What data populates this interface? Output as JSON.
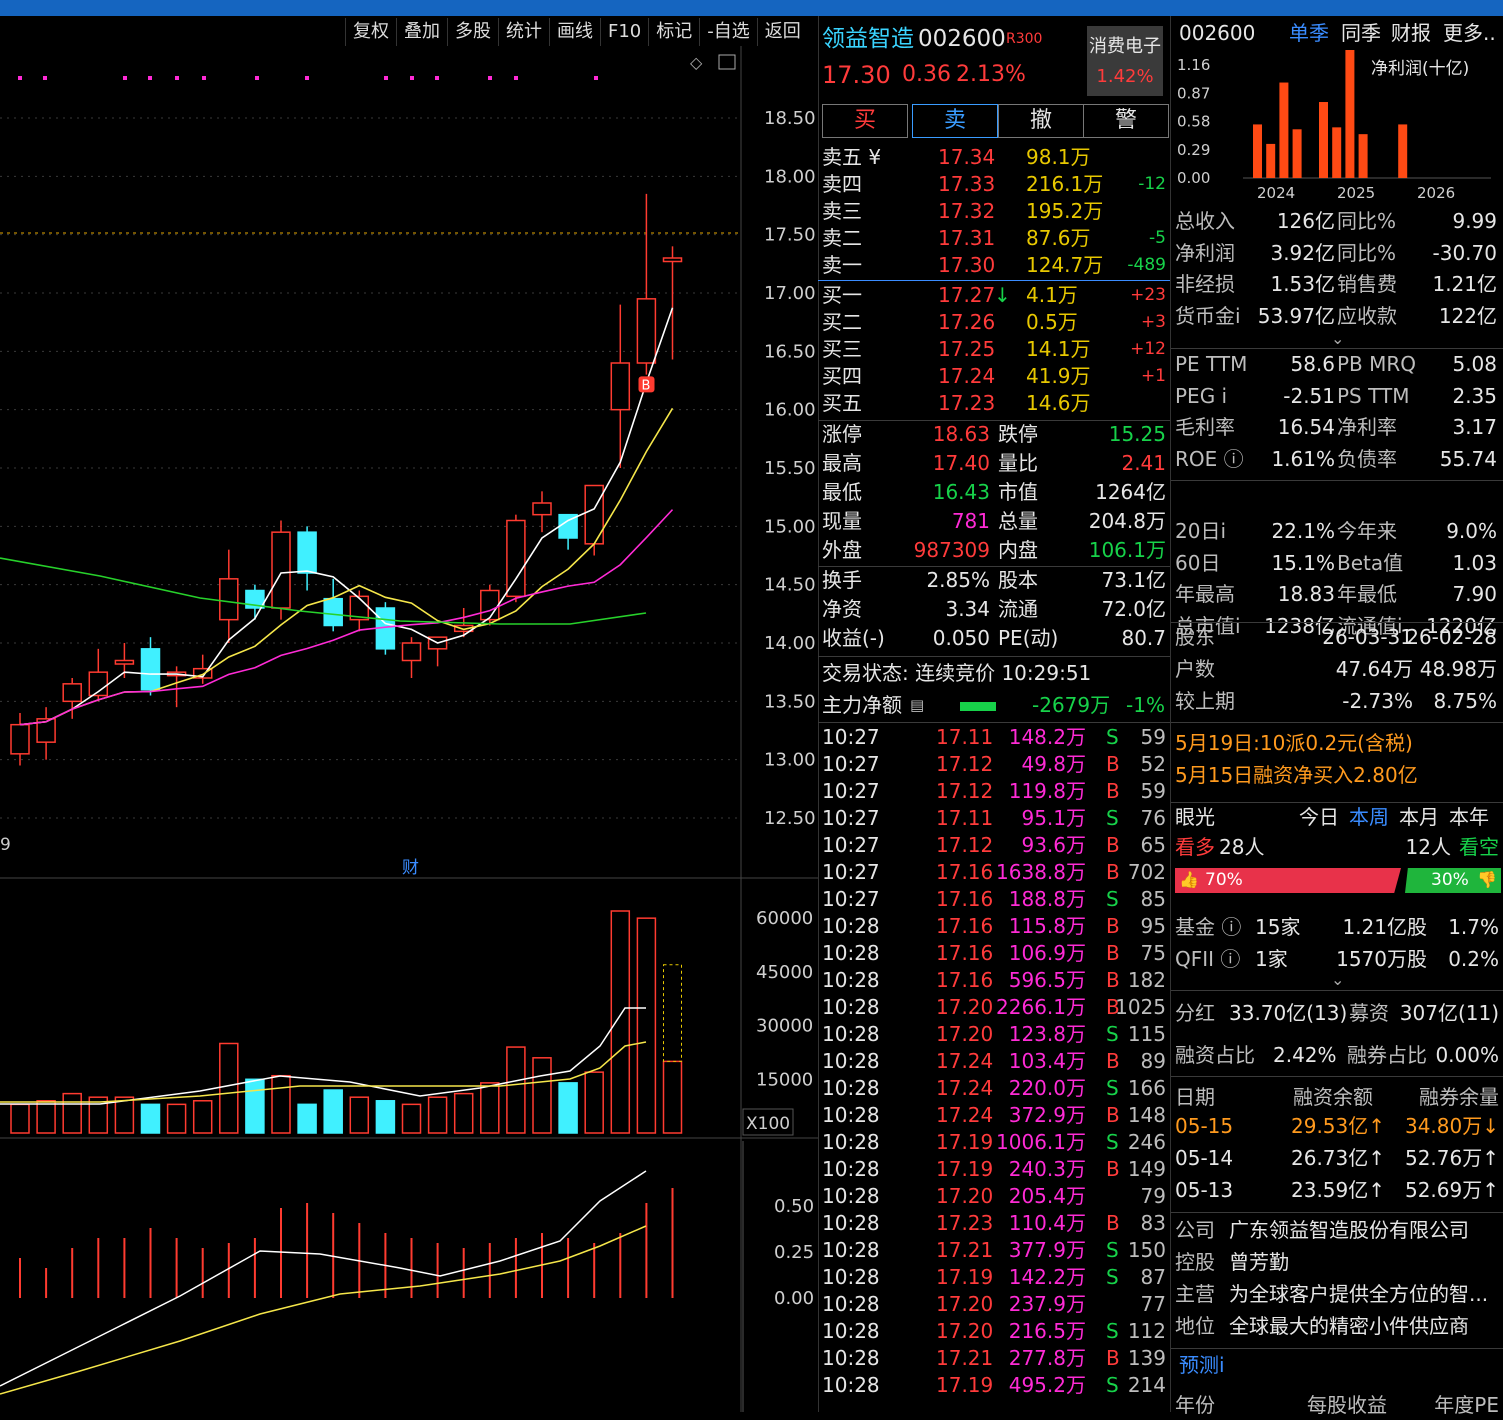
{
  "toolbar": [
    "复权",
    "叠加",
    "多股",
    "统计",
    "画线",
    "F10",
    "标记",
    "-自选",
    "返回"
  ],
  "chart": {
    "price_axis": [
      "18.50",
      "18.00",
      "17.50",
      "17.00",
      "16.50",
      "16.00",
      "15.50",
      "15.00",
      "14.50",
      "14.00",
      "13.50",
      "13.00",
      "12.50"
    ],
    "volume_axis": [
      "60000",
      "45000",
      "30000",
      "15000"
    ],
    "volume_unit": "X100",
    "macd_axis": [
      "0.50",
      "0.25",
      "0.00"
    ],
    "date_stub": "9",
    "fin_marker": "财",
    "buy_marker": "B",
    "colors": {
      "up": "#ff3b30",
      "down": "#40f0ff",
      "ma5": "#ffffff",
      "ma10": "#f5e64a",
      "ma20": "#ff2bd6",
      "ma60": "#27d12b"
    },
    "candles": [
      {
        "o": 13.05,
        "h": 13.4,
        "l": 12.95,
        "c": 13.3,
        "up": true
      },
      {
        "o": 13.15,
        "h": 13.45,
        "l": 13.0,
        "c": 13.35,
        "up": true
      },
      {
        "o": 13.5,
        "h": 13.7,
        "l": 13.35,
        "c": 13.65,
        "up": true
      },
      {
        "o": 13.55,
        "h": 13.95,
        "l": 13.5,
        "c": 13.75,
        "up": true
      },
      {
        "o": 13.82,
        "h": 14.0,
        "l": 13.7,
        "c": 13.85,
        "up": true
      },
      {
        "o": 13.95,
        "h": 14.05,
        "l": 13.55,
        "c": 13.6,
        "up": false
      },
      {
        "o": 13.72,
        "h": 13.8,
        "l": 13.45,
        "c": 13.75,
        "up": true
      },
      {
        "o": 13.7,
        "h": 13.9,
        "l": 13.65,
        "c": 13.78,
        "up": true
      },
      {
        "o": 14.2,
        "h": 14.8,
        "l": 14.0,
        "c": 14.55,
        "up": true
      },
      {
        "o": 14.45,
        "h": 14.5,
        "l": 14.2,
        "c": 14.3,
        "up": false
      },
      {
        "o": 14.3,
        "h": 15.05,
        "l": 14.2,
        "c": 14.95,
        "up": true
      },
      {
        "o": 14.95,
        "h": 15.0,
        "l": 14.45,
        "c": 14.6,
        "up": false
      },
      {
        "o": 14.38,
        "h": 14.55,
        "l": 14.1,
        "c": 14.15,
        "up": false
      },
      {
        "o": 14.2,
        "h": 14.45,
        "l": 14.1,
        "c": 14.4,
        "up": true
      },
      {
        "o": 14.3,
        "h": 14.35,
        "l": 13.9,
        "c": 13.95,
        "up": false
      },
      {
        "o": 13.85,
        "h": 14.05,
        "l": 13.7,
        "c": 14.0,
        "up": true
      },
      {
        "o": 13.95,
        "h": 14.05,
        "l": 13.8,
        "c": 14.05,
        "up": true
      },
      {
        "o": 14.1,
        "h": 14.3,
        "l": 14.05,
        "c": 14.15,
        "up": true
      },
      {
        "o": 14.2,
        "h": 14.5,
        "l": 14.15,
        "c": 14.45,
        "up": true
      },
      {
        "o": 14.4,
        "h": 15.1,
        "l": 14.35,
        "c": 15.05,
        "up": true
      },
      {
        "o": 15.1,
        "h": 15.3,
        "l": 14.95,
        "c": 15.2,
        "up": true
      },
      {
        "o": 15.1,
        "h": 15.1,
        "l": 14.8,
        "c": 14.9,
        "up": false
      },
      {
        "o": 14.85,
        "h": 15.35,
        "l": 14.75,
        "c": 15.35,
        "up": true
      },
      {
        "o": 16.0,
        "h": 16.9,
        "l": 15.5,
        "c": 16.4,
        "up": true
      },
      {
        "o": 16.4,
        "h": 17.85,
        "l": 16.3,
        "c": 16.95,
        "up": true
      },
      {
        "o": 17.3,
        "h": 17.4,
        "l": 16.43,
        "c": 17.27,
        "up": true
      }
    ],
    "volumes": [
      8000,
      9000,
      11000,
      10000,
      10000,
      8000,
      8000,
      9000,
      25000,
      15000,
      16000,
      8000,
      12000,
      10000,
      9000,
      8000,
      10000,
      11000,
      14000,
      24000,
      21000,
      14000,
      17000,
      62000,
      60000,
      20000
    ]
  },
  "quote": {
    "name": "领益智造",
    "code": "002600",
    "rank": "R300",
    "sector": "消费电子",
    "sector_pct": "1.42%",
    "price": "17.30",
    "change": "0.36",
    "pct": "2.13%",
    "buttons": [
      "买",
      "卖",
      "撤",
      "警"
    ],
    "sells": [
      {
        "label": "卖五 ¥",
        "price": "17.34",
        "vol": "98.1万",
        "diff": ""
      },
      {
        "label": "卖四",
        "price": "17.33",
        "vol": "216.1万",
        "diff": "-12"
      },
      {
        "label": "卖三",
        "price": "17.32",
        "vol": "195.2万",
        "diff": ""
      },
      {
        "label": "卖二",
        "price": "17.31",
        "vol": "87.6万",
        "diff": "-5"
      },
      {
        "label": "卖一",
        "price": "17.30",
        "vol": "124.7万",
        "diff": "-489"
      }
    ],
    "buys": [
      {
        "label": "买一",
        "price": "17.27",
        "vol": "4.1万",
        "diff": "+23"
      },
      {
        "label": "买二",
        "price": "17.26",
        "vol": "0.5万",
        "diff": "+3"
      },
      {
        "label": "买三",
        "price": "17.25",
        "vol": "14.1万",
        "diff": "+12"
      },
      {
        "label": "买四",
        "price": "17.24",
        "vol": "41.9万",
        "diff": "+1"
      },
      {
        "label": "买五",
        "price": "17.23",
        "vol": "14.6万",
        "diff": ""
      }
    ],
    "stats": [
      {
        "l1": "涨停",
        "v1": "18.63",
        "c1": "red",
        "l2": "跌停",
        "v2": "15.25",
        "c2": "grn"
      },
      {
        "l1": "最高",
        "v1": "17.40",
        "c1": "red",
        "l2": "量比",
        "v2": "2.41",
        "c2": "red"
      },
      {
        "l1": "最低",
        "v1": "16.43",
        "c1": "grn",
        "l2": "市值",
        "v2": "1264亿",
        "c2": "wht"
      },
      {
        "l1": "现量",
        "v1": "781",
        "c1": "mag",
        "l2": "总量",
        "v2": "204.8万",
        "c2": "wht"
      },
      {
        "l1": "外盘",
        "v1": "987309",
        "c1": "red",
        "l2": "内盘",
        "v2": "106.1万",
        "c2": "grn"
      }
    ],
    "stats2": [
      {
        "l1": "换手",
        "v1": "2.85%",
        "l2": "股本",
        "v2": "73.1亿"
      },
      {
        "l1": "净资",
        "v1": "3.34",
        "l2": "流通",
        "v2": "72.0亿"
      },
      {
        "l1": "收益(-)",
        "v1": "0.050",
        "l2": "PE(动)",
        "v2": "80.7"
      }
    ],
    "status": "交易状态: 连续竞价 10:29:51",
    "mainflow_label": "主力净额",
    "mainflow_value": "-2679万",
    "mainflow_pct": "-1%"
  },
  "ticks": [
    {
      "t": "10:27",
      "p": "17.11",
      "v": "148.2万",
      "bs": "S",
      "n": "59",
      "pc": "red"
    },
    {
      "t": "10:27",
      "p": "17.12",
      "v": "49.8万",
      "bs": "B",
      "n": "52",
      "pc": "red"
    },
    {
      "t": "10:27",
      "p": "17.12",
      "v": "119.8万",
      "bs": "B",
      "n": "59",
      "pc": "red"
    },
    {
      "t": "10:27",
      "p": "17.11",
      "v": "95.1万",
      "bs": "S",
      "n": "76",
      "pc": "red"
    },
    {
      "t": "10:27",
      "p": "17.12",
      "v": "93.6万",
      "bs": "B",
      "n": "65",
      "pc": "red"
    },
    {
      "t": "10:27",
      "p": "17.16",
      "v": "1638.8万",
      "bs": "B",
      "n": "702",
      "pc": "red"
    },
    {
      "t": "10:27",
      "p": "17.16",
      "v": "188.8万",
      "bs": "S",
      "n": "85",
      "pc": "red"
    },
    {
      "t": "10:28",
      "p": "17.16",
      "v": "115.8万",
      "bs": "B",
      "n": "95",
      "pc": "red"
    },
    {
      "t": "10:28",
      "p": "17.16",
      "v": "106.9万",
      "bs": "B",
      "n": "75",
      "pc": "red"
    },
    {
      "t": "10:28",
      "p": "17.16",
      "v": "596.5万",
      "bs": "B",
      "n": "182",
      "pc": "red"
    },
    {
      "t": "10:28",
      "p": "17.20",
      "v": "2266.1万",
      "bs": "B",
      "n": "1025",
      "pc": "red"
    },
    {
      "t": "10:28",
      "p": "17.20",
      "v": "123.8万",
      "bs": "S",
      "n": "115",
      "pc": "red"
    },
    {
      "t": "10:28",
      "p": "17.24",
      "v": "103.4万",
      "bs": "B",
      "n": "89",
      "pc": "red"
    },
    {
      "t": "10:28",
      "p": "17.24",
      "v": "220.0万",
      "bs": "S",
      "n": "166",
      "pc": "red"
    },
    {
      "t": "10:28",
      "p": "17.24",
      "v": "372.9万",
      "bs": "B",
      "n": "148",
      "pc": "red"
    },
    {
      "t": "10:28",
      "p": "17.19",
      "v": "1006.1万",
      "bs": "S",
      "n": "246",
      "pc": "red"
    },
    {
      "t": "10:28",
      "p": "17.19",
      "v": "240.3万",
      "bs": "B",
      "n": "149",
      "pc": "red"
    },
    {
      "t": "10:28",
      "p": "17.20",
      "v": "205.4万",
      "bs": "",
      "n": "79",
      "pc": "red"
    },
    {
      "t": "10:28",
      "p": "17.23",
      "v": "110.4万",
      "bs": "B",
      "n": "83",
      "pc": "red"
    },
    {
      "t": "10:28",
      "p": "17.21",
      "v": "377.9万",
      "bs": "S",
      "n": "150",
      "pc": "red"
    },
    {
      "t": "10:28",
      "p": "17.19",
      "v": "142.2万",
      "bs": "S",
      "n": "87",
      "pc": "red"
    },
    {
      "t": "10:28",
      "p": "17.20",
      "v": "237.9万",
      "bs": "",
      "n": "77",
      "pc": "red"
    },
    {
      "t": "10:28",
      "p": "17.20",
      "v": "216.5万",
      "bs": "S",
      "n": "112",
      "pc": "red"
    },
    {
      "t": "10:28",
      "p": "17.21",
      "v": "277.8万",
      "bs": "B",
      "n": "139",
      "pc": "red"
    },
    {
      "t": "10:28",
      "p": "17.19",
      "v": "495.2万",
      "bs": "S",
      "n": "214",
      "pc": "red"
    }
  ],
  "fin": {
    "code": "002600",
    "tabs": [
      "单季",
      "同季",
      "财报",
      "更多.."
    ],
    "chart_title": "净利润(十亿)",
    "y_ticks": [
      "1.16",
      "0.87",
      "0.58",
      "0.29",
      "0.00"
    ],
    "x_ticks": [
      "2024",
      "2025",
      "2026"
    ],
    "bars": [
      0.55,
      0.35,
      0.98,
      0.5,
      0.0,
      0.78,
      0.52,
      1.38,
      0.45,
      0.0,
      0.0,
      0.55
    ],
    "rows": [
      {
        "l1": "总收入",
        "v1": "126亿",
        "l2": "同比%",
        "v2": "9.99"
      },
      {
        "l1": "净利润",
        "v1": "3.92亿",
        "l2": "同比%",
        "v2": "-30.70"
      },
      {
        "l1": "非经损",
        "v1": "1.53亿",
        "l2": "销售费",
        "v2": "1.21亿"
      },
      {
        "l1": "货币金i",
        "v1": "53.97亿",
        "l2": "应收款",
        "v2": "122亿"
      }
    ],
    "rows2": [
      {
        "l1": "PE TTM",
        "v1": "58.6",
        "l2": "PB MRQ",
        "v2": "5.08"
      },
      {
        "l1": "PEG i",
        "v1": "-2.51",
        "l2": "PS TTM",
        "v2": "2.35"
      },
      {
        "l1": "毛利率",
        "v1": "16.54",
        "l2": "净利率",
        "v2": "3.17"
      },
      {
        "l1": "ROE ⓘ",
        "v1": "1.61%",
        "l2": "负债率",
        "v2": "55.74"
      }
    ],
    "rows3": [
      {
        "l1": "20日i",
        "v1": "22.1%",
        "l2": "今年来",
        "v2": "9.0%"
      },
      {
        "l1": "60日",
        "v1": "15.1%",
        "l2": "Beta值",
        "v2": "1.03"
      },
      {
        "l1": "年最高",
        "v1": "18.83",
        "l2": "年最低",
        "v2": "7.90"
      },
      {
        "l1": "总市值i",
        "v1": "1238亿",
        "l2": "流通值i",
        "v2": "1220亿"
      }
    ],
    "holders": [
      {
        "l": "股东",
        "a": "26-03-31",
        "b": "26-02-28"
      },
      {
        "l": "户数",
        "a": "47.64万",
        "b": "48.98万"
      },
      {
        "l": "较上期",
        "a": "-2.73%",
        "b": "8.75%"
      }
    ],
    "news": [
      "5月19日:10派0.2元(含税)",
      "5月15日融资净买入2.80亿"
    ],
    "vision": {
      "label": "眼光",
      "tabs": [
        "今日",
        "本周",
        "本月",
        "本年"
      ],
      "bull_label": "看多",
      "bull_n": "28人",
      "bear_n": "12人",
      "bear_label": "看空",
      "bull_pct": "70%",
      "bear_pct": "30%"
    },
    "funds": [
      {
        "l": "基金 ⓘ",
        "a": "15家",
        "b": "1.21亿股",
        "c": "1.7%"
      },
      {
        "l": "QFII ⓘ",
        "a": "1家",
        "b": "1570万股",
        "c": "0.2%"
      }
    ],
    "dividend": {
      "l1": "分红",
      "v1": "33.70亿(13)",
      "l2": "募资",
      "v2": "307亿(11)"
    },
    "margin_ratio": {
      "l1": "融资占比",
      "v1": "2.42%",
      "l2": "融券占比",
      "v2": "0.00%"
    },
    "margin_head": [
      "日期",
      "融资余额",
      "融券余量"
    ],
    "margin_rows": [
      {
        "d": "05-15",
        "a": "29.53亿↑",
        "b": "34.80万↓"
      },
      {
        "d": "05-14",
        "a": "26.73亿↑",
        "b": "52.76万↑"
      },
      {
        "d": "05-13",
        "a": "23.59亿↑",
        "b": "52.69万↑"
      }
    ],
    "company": [
      {
        "l": "公司",
        "v": "广东领益智造股份有限公司"
      },
      {
        "l": "控股",
        "v": "曾芳勤"
      },
      {
        "l": "主营",
        "v": "为全球客户提供全方位的智..."
      },
      {
        "l": "地位",
        "v": "全球最大的精密小件供应商"
      }
    ],
    "forecast": "预测i",
    "footer": [
      "年份",
      "每股收益",
      "年度PE"
    ]
  }
}
